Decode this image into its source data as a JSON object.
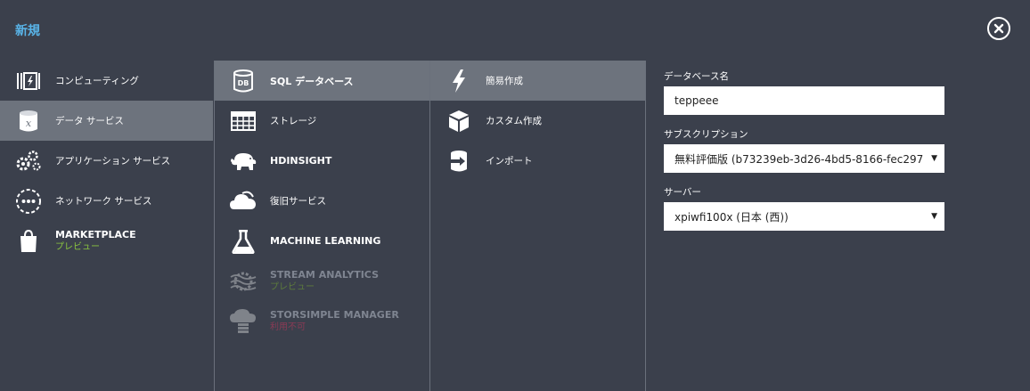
{
  "header": {
    "title": "新規"
  },
  "close": {
    "icon": "close-icon"
  },
  "categories": [
    {
      "label": "コンピューティング",
      "icon": "compute-icon",
      "selected": false
    },
    {
      "label": "データ サービス",
      "icon": "data-services-icon",
      "selected": true
    },
    {
      "label": "アプリケーション サービス",
      "icon": "app-services-icon",
      "selected": false
    },
    {
      "label": "ネットワーク サービス",
      "icon": "network-services-icon",
      "selected": false
    },
    {
      "label": "MARKETPLACE",
      "sub": "プレビュー",
      "icon": "marketplace-icon",
      "selected": false
    }
  ],
  "services": [
    {
      "label": "SQL データベース",
      "icon": "database-icon",
      "selected": true
    },
    {
      "label": "ストレージ",
      "icon": "storage-icon"
    },
    {
      "label": "HDINSIGHT",
      "icon": "hdinsight-icon"
    },
    {
      "label": "復旧サービス",
      "icon": "recovery-services-icon"
    },
    {
      "label": "MACHINE LEARNING",
      "icon": "machine-learning-icon"
    },
    {
      "label": "STREAM ANALYTICS",
      "sub": "プレビュー",
      "icon": "stream-analytics-icon",
      "disabled": true
    },
    {
      "label": "STORSIMPLE MANAGER",
      "sub": "利用不可",
      "icon": "storsimple-icon",
      "disabled": true
    }
  ],
  "actions": [
    {
      "label": "簡易作成",
      "icon": "lightning-icon",
      "selected": true
    },
    {
      "label": "カスタム作成",
      "icon": "box-icon"
    },
    {
      "label": "インポート",
      "icon": "import-icon"
    }
  ],
  "form": {
    "db_name_label": "データベース名",
    "db_name_value": "teppeee",
    "subscription_label": "サブスクリプション",
    "subscription_value": "無料評価版 (b73239eb-3d26-4bd5-8166-fec297",
    "server_label": "サーバー",
    "server_value": "xpiwfi100x (日本 (西))"
  }
}
